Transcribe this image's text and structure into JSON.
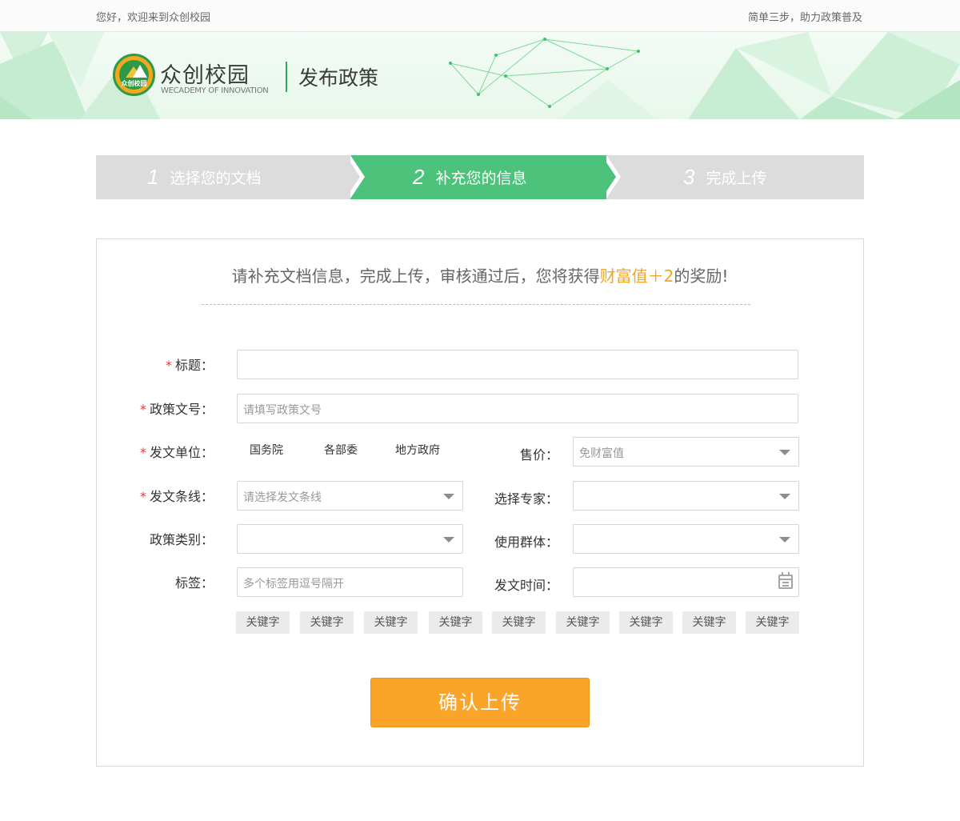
{
  "topbar": {
    "greeting": "您好，欢迎来到众创校园",
    "slogan": "简单三步，助力政策普及"
  },
  "header": {
    "logo_badge_text": "众创校园",
    "logo_name": "众创校园",
    "logo_en": "WECADEMY OF INNOVATION",
    "page_name": "发布政策"
  },
  "steps": [
    {
      "num": "1",
      "label": "选择您的文档",
      "active": false
    },
    {
      "num": "2",
      "label": "补充您的信息",
      "active": true
    },
    {
      "num": "3",
      "label": "完成上传",
      "active": false
    }
  ],
  "form": {
    "intro_prefix": "请补充文档信息，完成上传，审核通过后，您将获得",
    "intro_highlight": "财富值＋2",
    "intro_suffix": "的奖励!",
    "title_label": "标题：",
    "doc_no_label": "政策文号：",
    "doc_no_placeholder": "请填写政策文号",
    "issuer_label": "发文单位：",
    "issuer_options": [
      "国务院",
      "各部委",
      "地方政府"
    ],
    "price_label": "售价：",
    "price_value": "免财富值",
    "line_label": "发文条线：",
    "line_placeholder": "请选择发文条线",
    "expert_label": "选择专家：",
    "category_label": "政策类别：",
    "audience_label": "使用群体：",
    "tags_label": "标签：",
    "tags_placeholder": "多个标签用逗号隔开",
    "date_label": "发文时间：",
    "keywords": [
      "关键字",
      "关键字",
      "关键字",
      "关键字",
      "关键字",
      "关键字",
      "关键字",
      "关键字",
      "关键字"
    ],
    "submit_label": "确认上传"
  },
  "colors": {
    "accent_green": "#4cc27b",
    "accent_orange": "#fba42a",
    "highlight": "#f5a623",
    "required": "#e5383b"
  }
}
